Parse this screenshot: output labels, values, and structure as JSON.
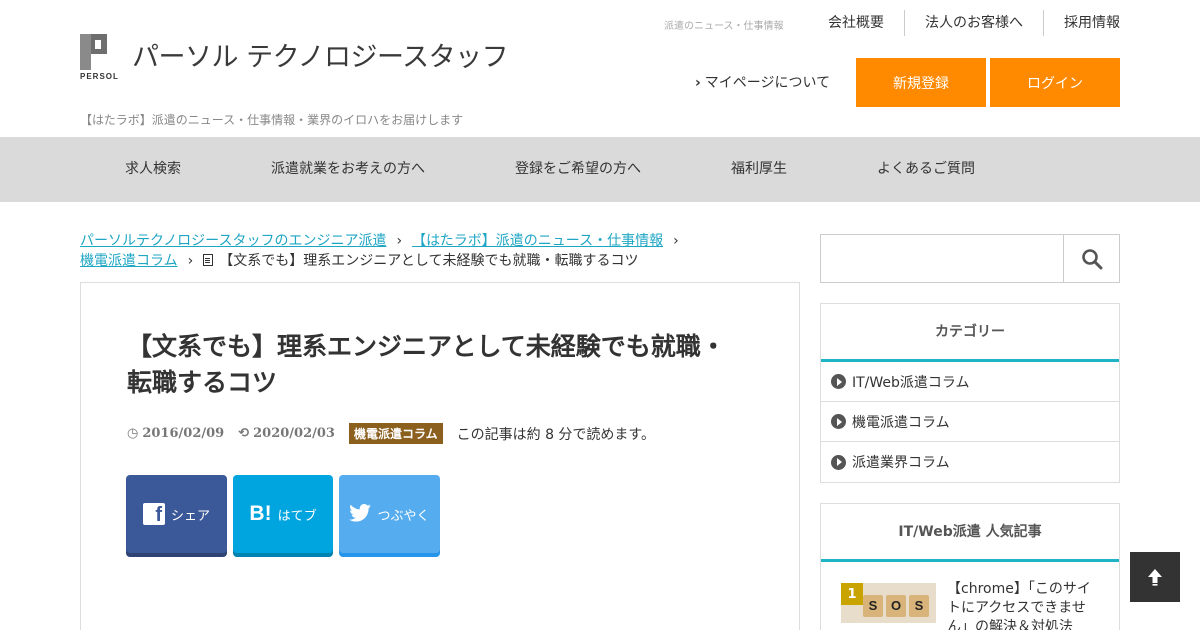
{
  "header": {
    "logo_text": "パーソル テクノロジースタッフ",
    "logo_mark_text": "PERSOL",
    "tagline": "【はたラボ】派遣のニュース・仕事情報・業界のイロハをお届けします",
    "top_small": "派遣のニュース・仕事情報",
    "top_links": [
      "会社概要",
      "法人のお客様へ",
      "採用情報"
    ],
    "mypage_label": "マイページについて",
    "register_label": "新規登録",
    "login_label": "ログイン",
    "accent_color": "#ff8a00"
  },
  "nav": {
    "items": [
      "求人検索",
      "派遣就業をお考えの方へ",
      "登録をご希望の方へ",
      "福利厚生",
      "よくあるご質問"
    ]
  },
  "breadcrumb": {
    "items": [
      "パーソルテクノロジースタッフのエンジニア派遣",
      "【はたラボ】派遣のニュース・仕事情報",
      "機電派遣コラム"
    ],
    "current": "【文系でも】理系エンジニアとして未経験でも就職・転職するコツ"
  },
  "article": {
    "title": "【文系でも】理系エンジニアとして未経験でも就職・転職するコツ",
    "published": "2016/02/09",
    "updated": "2020/02/03",
    "category": "機電派遣コラム",
    "reading_time": "この記事は約 8 分で読めます。",
    "share": {
      "facebook": "シェア",
      "hatena": "はてブ",
      "twitter": "つぶやく"
    }
  },
  "sidebar": {
    "search_placeholder": "",
    "category_title": "カテゴリー",
    "categories": [
      "IT/Web派遣コラム",
      "機電派遣コラム",
      "派遣業界コラム"
    ],
    "popular_title": "IT/Web派遣 人気記事",
    "popular": [
      {
        "rank": "1",
        "title": "【chrome】「このサイトにアクセスできません」の解決＆対処法",
        "thumb_text": [
          "S",
          "O",
          "S"
        ]
      }
    ]
  },
  "colors": {
    "teal": "#1fb4c4",
    "link": "#1fa6c4",
    "nav_bg": "#dadada",
    "badge": "#8b5f1e"
  }
}
